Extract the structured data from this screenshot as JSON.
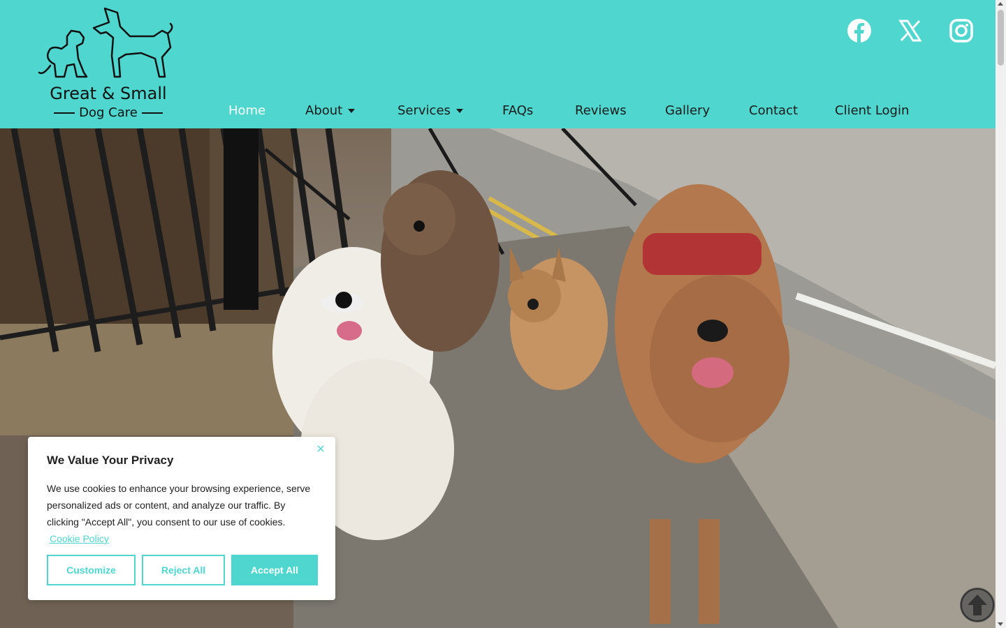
{
  "brand": {
    "line1": "Great & Small",
    "line2": "Dog Care",
    "colors": {
      "accent": "#4fd6cf",
      "text": "#1a1a1a"
    }
  },
  "social": [
    {
      "name": "facebook-icon"
    },
    {
      "name": "x-icon"
    },
    {
      "name": "instagram-icon"
    }
  ],
  "nav": {
    "items": [
      {
        "label": "Home",
        "active": true
      },
      {
        "label": "About",
        "dropdown": true
      },
      {
        "label": "Services",
        "dropdown": true
      },
      {
        "label": "FAQs"
      },
      {
        "label": "Reviews"
      },
      {
        "label": "Gallery"
      },
      {
        "label": "Contact"
      },
      {
        "label": "Client Login"
      }
    ]
  },
  "hero": {
    "image": "photo of four dogs on leads on a paved sidewalk"
  },
  "cookie": {
    "title": "We Value Your Privacy",
    "body": "We use cookies to enhance your browsing experience, serve personalized ads or content, and analyze our traffic. By clicking \"Accept All\", you consent to our use of cookies.",
    "link": "Cookie Policy",
    "buttons": {
      "customize": "Customize",
      "reject": "Reject All",
      "accept": "Accept All"
    }
  }
}
